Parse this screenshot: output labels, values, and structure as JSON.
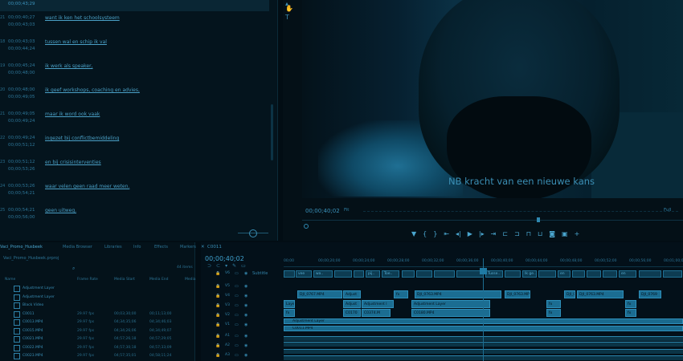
{
  "captions": {
    "top_timecode": "00;00;43;29",
    "rows": [
      {
        "num": "21",
        "in": "00;00;40;27",
        "out": "00;00;43;03",
        "text": "want ik ken het schoolsysteem"
      },
      {
        "num": "18",
        "in": "00;00;43;03",
        "out": "00;00;44;24",
        "text": "tussen wal en schip ik val"
      },
      {
        "num": "19",
        "in": "00;00;45;24",
        "out": "00;00;48;00",
        "text": "ik werk als speaker,"
      },
      {
        "num": "20",
        "in": "00;00;48;00",
        "out": "00;00;49;05",
        "text": "ik geef workshops, coaching en advies,"
      },
      {
        "num": "21",
        "in": "00;00;49;05",
        "out": "00;00;49;24",
        "text": "maar ik word ook vaak"
      },
      {
        "num": "22",
        "in": "00;00;49;24",
        "out": "00;00;51;12",
        "text": "ingezet bij conflictbemiddeling"
      },
      {
        "num": "23",
        "in": "00;00;51;12",
        "out": "00;00;53;26",
        "text": "en bij crisisinterventies"
      },
      {
        "num": "24",
        "in": "00;00;53;26",
        "out": "00;00;54;21",
        "text": "waar velen geen raad meer weten."
      },
      {
        "num": "25",
        "in": "00;00;54;21",
        "out": "00;00;56;00",
        "text": "geen uitweg."
      }
    ]
  },
  "tools": [
    "hand-tool",
    "type-tool"
  ],
  "monitor": {
    "subtitle": "NB kracht van een nieuwe kans",
    "timecode": "00;00;40;02",
    "fit": "Fit",
    "resolution": "Full",
    "transport": [
      "mark-in",
      "mark-out",
      "mark-clip",
      "go-to-in",
      "step-back",
      "play",
      "step-forward",
      "go-to-out",
      "insert",
      "overwrite",
      "lift",
      "extract",
      "export-frame",
      "comparison",
      "add-button"
    ]
  },
  "project": {
    "tabs": [
      "Vaci_Promo_Husbeek",
      "Media Browser",
      "Libraries",
      "Info",
      "Effects",
      "Markers"
    ],
    "path": "Vaci_Promo_Husbeek.prproj",
    "count": "44 items",
    "columns": [
      "Name",
      "Frame Rate",
      "Media Start",
      "Media End",
      "Media"
    ],
    "items": [
      {
        "name": "Adjustment Layer",
        "rate": "",
        "start": "",
        "end": ""
      },
      {
        "name": "Adjustment Layer",
        "rate": "",
        "start": "",
        "end": ""
      },
      {
        "name": "Black Video",
        "rate": "",
        "start": "",
        "end": ""
      },
      {
        "name": "C0011",
        "rate": "29.97 fps",
        "start": "00;03;30;00",
        "end": "00;11;13;00"
      },
      {
        "name": "C0013.MP4",
        "rate": "29.97 fps",
        "start": "04;34;35;06",
        "end": "04;34;46;03"
      },
      {
        "name": "C0015.MP4",
        "rate": "29.97 fps",
        "start": "04;34;26;06",
        "end": "04;34;49;07"
      },
      {
        "name": "C0021.MP4",
        "rate": "29.97 fps",
        "start": "04;57;26;18",
        "end": "04;57;29;05"
      },
      {
        "name": "C0022.MP4",
        "rate": "29.97 fps",
        "start": "04;57;30;18",
        "end": "04;57;33;09"
      },
      {
        "name": "C0023.MP4",
        "rate": "29.97 fps",
        "start": "04;57;35;01",
        "end": "04;58;11;24"
      }
    ]
  },
  "timeline": {
    "sequence": "C0011",
    "timecode": "00;00;40;02",
    "ruler": [
      "00;00",
      "00;00;20;00",
      "00;00;24;00",
      "00;00;28;00",
      "00;00;32;00",
      "00;00;36;00",
      "00;00;40;00",
      "00;00;44;00",
      "00;00;48;00",
      "00;00;52;00",
      "00;00;56;00",
      "00;01;00;00"
    ],
    "subtitle_track": "Subtitle",
    "caption_clips": [
      "",
      "vee",
      "wa..",
      "",
      "",
      "pij..",
      "Toe..",
      "",
      "",
      "",
      "",
      "Tusse..",
      "",
      "Ik ge..",
      "",
      "en",
      "",
      "",
      "",
      "en",
      "",
      ""
    ],
    "v4": [
      {
        "label": "DJI_0767.MP4"
      },
      {
        "label": "Adjust"
      },
      {
        "label": "fx"
      },
      {
        "label": "DJI_0763.MP4"
      },
      {
        "label": "DJI_0763.MP4"
      },
      {
        "label": "DJI_0"
      },
      {
        "label": "DJI_0763.MP4"
      },
      {
        "label": "DJI_0769"
      }
    ],
    "v3": [
      {
        "label": "Layer"
      },
      {
        "label": "Adjust"
      },
      {
        "label": "Adjustment l"
      },
      {
        "label": "Adjustment Layer"
      },
      {
        "label": "fx"
      },
      {
        "label": "fx"
      }
    ],
    "v2": [
      {
        "label": "fx"
      },
      {
        "label": "C0170"
      },
      {
        "label": "C0374.M"
      },
      {
        "label": "C0180.MP4"
      },
      {
        "label": "fx"
      },
      {
        "label": "fx"
      }
    ],
    "v1_bar": "Adjustment Layer",
    "v1b_bar": "C0011.MP4",
    "track_labels": [
      "V6",
      "V5",
      "V4",
      "V3",
      "V2",
      "V1",
      "A1",
      "A2",
      "A3"
    ]
  }
}
